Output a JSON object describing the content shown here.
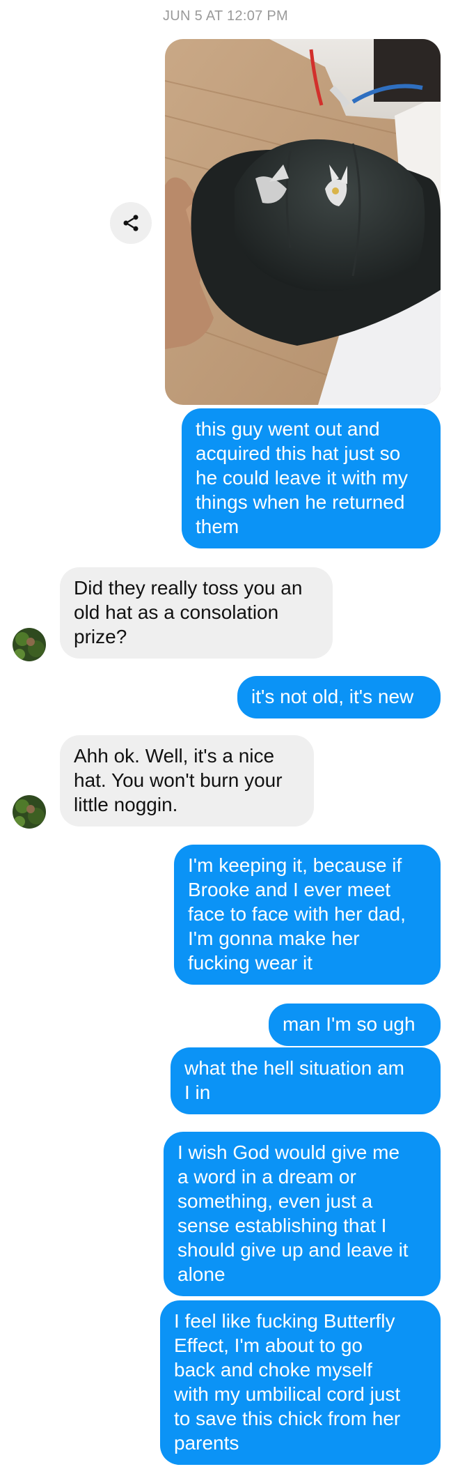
{
  "timestamp": "JUN 5 AT 12:07 PM",
  "share_icon": "share-icon",
  "messages": [
    {
      "from": "me",
      "lines": [
        "this guy went out and",
        "acquired this hat just so",
        "he could leave it with my",
        "things when he returned",
        "them"
      ]
    },
    {
      "from": "them",
      "lines": [
        "Did they really toss you an",
        "old hat as a consolation",
        "prize?"
      ]
    },
    {
      "from": "me",
      "lines": [
        "it's not old, it's new"
      ]
    },
    {
      "from": "them",
      "lines": [
        "Ahh ok. Well, it's a nice",
        "hat. You won't burn your",
        "little noggin."
      ]
    },
    {
      "from": "me",
      "lines": [
        "I'm keeping it, because if",
        "Brooke and I ever meet",
        "face to face with her dad,",
        "I'm gonna make her",
        "fucking wear it"
      ]
    },
    {
      "from": "me",
      "lines": [
        "man I'm so ugh"
      ]
    },
    {
      "from": "me",
      "lines": [
        "what the hell situation am",
        "I in"
      ]
    },
    {
      "from": "me",
      "lines": [
        "I wish God would give me",
        "a word in a dream or",
        "something, even just a",
        "sense establishing that I",
        "should give up and leave it",
        "alone"
      ]
    },
    {
      "from": "me",
      "lines": [
        "I feel like fucking Butterfly",
        "Effect, I'm about to go",
        "back and choke myself",
        "with my umbilical cord just",
        "to save this chick from her",
        "parents"
      ]
    }
  ],
  "colors": {
    "outgoing": "#0b93f6",
    "incoming": "#efefef",
    "timestamp": "#9a9a9a"
  }
}
